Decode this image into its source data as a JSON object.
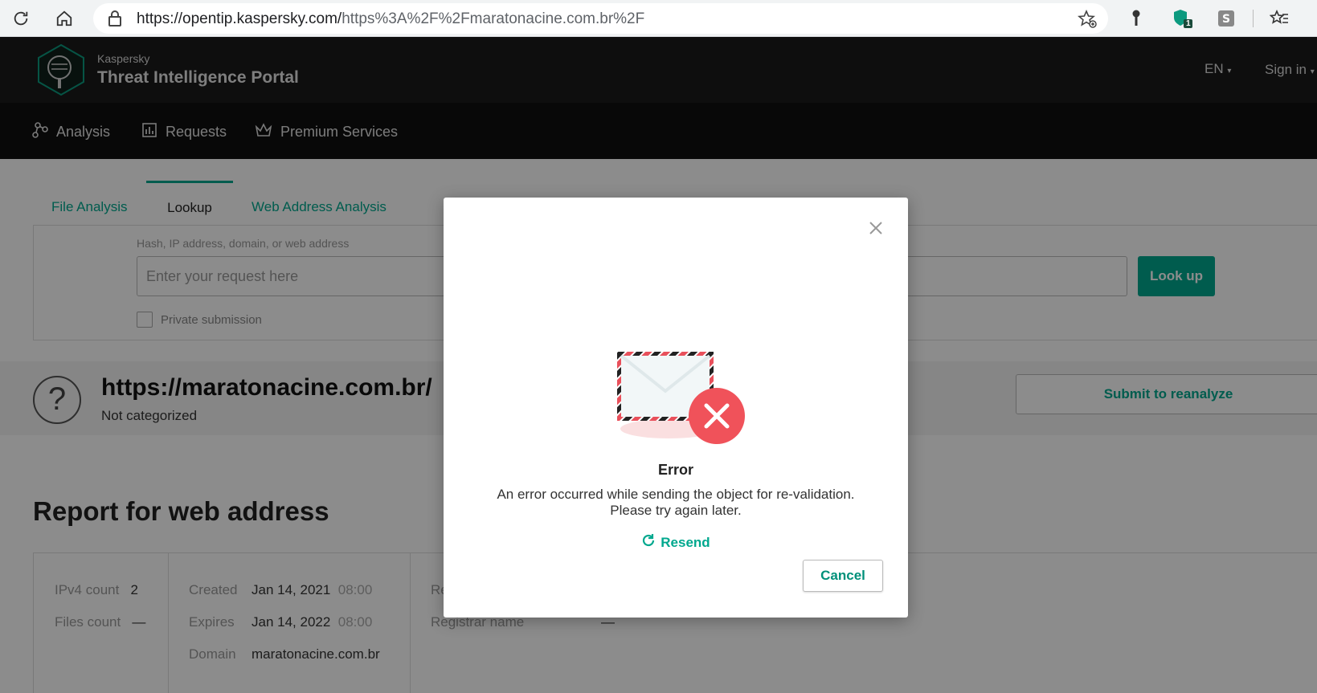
{
  "browser": {
    "url_host": "https://opentip.kaspersky.com/",
    "url_rest": "https%3A%2F%2Fmaratonacine.com.br%2F",
    "extension_badge": "1"
  },
  "header": {
    "brand_small": "Kaspersky",
    "brand_big": "Threat Intelligence Portal",
    "lang": "EN",
    "signin": "Sign in"
  },
  "nav": {
    "items": [
      "Analysis",
      "Requests",
      "Premium Services"
    ]
  },
  "tabs": [
    "File Analysis",
    "Lookup",
    "Web Address Analysis"
  ],
  "search": {
    "hint": "Hash, IP address, domain, or web address",
    "placeholder": "Enter your request here",
    "button": "Look up",
    "private_label": "Private submission"
  },
  "result": {
    "url": "https://maratonacine.com.br/",
    "category": "Not categorized",
    "reanalyze": "Submit to reanalyze"
  },
  "report": {
    "title": "Report for web address",
    "ipv4_label": "IPv4 count",
    "ipv4_value": "2",
    "files_label": "Files count",
    "files_value": "—",
    "created_label": "Created",
    "created_date": "Jan 14, 2021",
    "created_time": "08:00",
    "expires_label": "Expires",
    "expires_date": "Jan 14, 2022",
    "expires_time": "08:00",
    "domain_label": "Domain",
    "domain_value": "maratonacine.com.br",
    "re_partial": "Re",
    "registrar_label": "Registrar name",
    "registrar_value": "—"
  },
  "modal": {
    "title": "Error",
    "message_line1": "An error occurred while sending the object for re-validation.",
    "message_line2": "Please try again later.",
    "resend": "Resend",
    "cancel": "Cancel"
  },
  "colors": {
    "accent": "#00a88e",
    "error": "#f0525a",
    "header_bg": "#1a1a1a"
  }
}
